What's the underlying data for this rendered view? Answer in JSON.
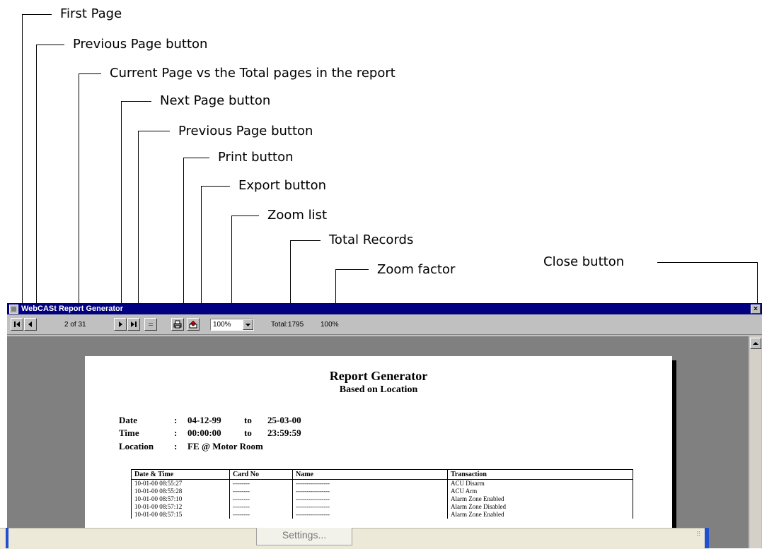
{
  "annotations": [
    {
      "id": "first-page",
      "text": "First Page"
    },
    {
      "id": "previous-page-1",
      "text": "Previous Page button"
    },
    {
      "id": "current-page",
      "text": "Current Page vs the Total pages in the report"
    },
    {
      "id": "next-page",
      "text": "Next Page button"
    },
    {
      "id": "previous-page-2",
      "text": "Previous Page button"
    },
    {
      "id": "print",
      "text": "Print button"
    },
    {
      "id": "export",
      "text": "Export button"
    },
    {
      "id": "zoom-list",
      "text": "Zoom list"
    },
    {
      "id": "total-records",
      "text": "Total Records"
    },
    {
      "id": "zoom-factor",
      "text": "Zoom factor"
    },
    {
      "id": "close",
      "text": "Close button"
    }
  ],
  "window": {
    "title": "WebCASt Report Generator",
    "close_glyph": "×"
  },
  "toolbar": {
    "page_indicator": "2 of 31",
    "zoom_value": "100%",
    "total_records": "Total:1795",
    "zoom_factor": "100%"
  },
  "icons": {
    "first": "first-page-icon",
    "prev": "previous-page-icon",
    "next": "next-page-icon",
    "last": "last-page-icon",
    "stop": "stop-icon",
    "print": "printer-icon",
    "export": "export-icon",
    "dropdown": "chevron-down-icon"
  },
  "report": {
    "title": "Report Generator",
    "subtitle": "Based on Location",
    "date_label": "Date",
    "date_from": "04-12-99",
    "date_to": "25-03-00",
    "time_label": "Time",
    "time_from": "00:00:00",
    "time_to": "23:59:59",
    "to_word": "to",
    "separator": ":",
    "location_label": "Location",
    "location_value": "FE @ Motor Room",
    "columns": [
      "Date  & Time",
      "Card No",
      "Name",
      "Transaction"
    ],
    "rows": [
      [
        "10-01-00 08:55:27",
        "--------",
        "----------------",
        "ACU Disarm"
      ],
      [
        "10-01-00 08:55:28",
        "--------",
        "----------------",
        "ACU Arm"
      ],
      [
        "10-01-00 08:57:10",
        "--------",
        "----------------",
        "Alarm Zone Enabled"
      ],
      [
        "10-01-00 08:57:12",
        "--------",
        "----------------",
        "Alarm Zone Disabled"
      ],
      [
        "10-01-00 08:57:15",
        "--------",
        "----------------",
        "Alarm Zone Enabled"
      ]
    ]
  },
  "bottom": {
    "settings_label": "Settings..."
  },
  "colors": {
    "titlebar": "#000080",
    "chrome": "#c0c0c0",
    "viewer_bg": "#808080"
  }
}
